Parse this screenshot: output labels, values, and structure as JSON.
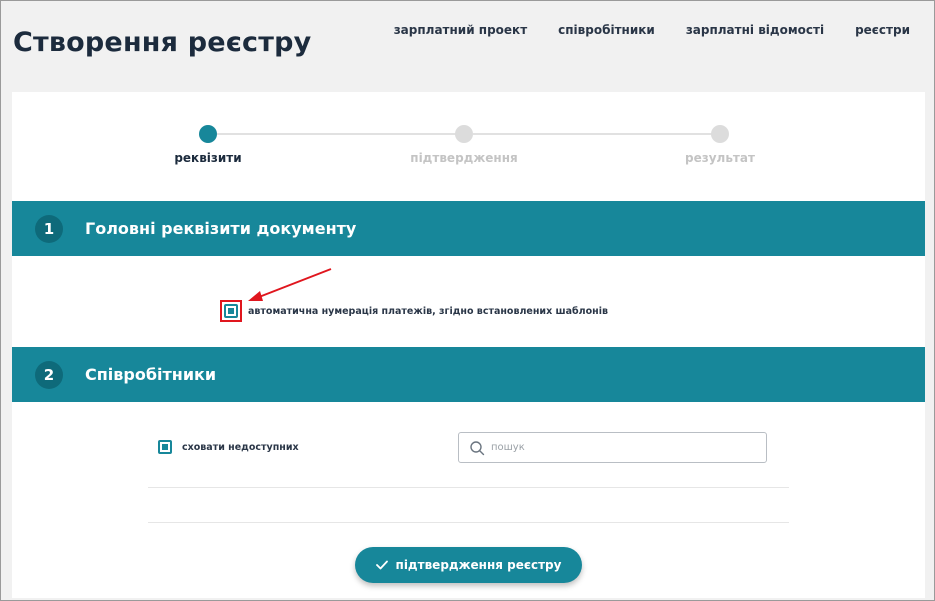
{
  "header": {
    "title": "Створення реєстру",
    "nav": [
      "зарплатний проект",
      "співробітники",
      "зарплатні відомості",
      "реєстри"
    ]
  },
  "stepper": {
    "steps": [
      {
        "label": "реквізити",
        "active": true
      },
      {
        "label": "підтвердження",
        "active": false
      },
      {
        "label": "результат",
        "active": false
      }
    ]
  },
  "section1": {
    "number": "1",
    "title": "Головні реквізити документу",
    "auto_numbering_label": "автоматична нумерація платежів, згідно встановлених шаблонів",
    "auto_numbering_checked": true
  },
  "section2": {
    "number": "2",
    "title": "Співробітники",
    "hide_unavailable_label": "сховати недоступних",
    "hide_unavailable_checked": true,
    "search_placeholder": "пошук",
    "search_value": ""
  },
  "actions": {
    "confirm_label": "підтвердження реєстру"
  },
  "colors": {
    "accent": "#17879a",
    "annotation": "#e0161e"
  },
  "icons": [
    "search-icon",
    "check-icon",
    "annotation-arrow-icon"
  ]
}
